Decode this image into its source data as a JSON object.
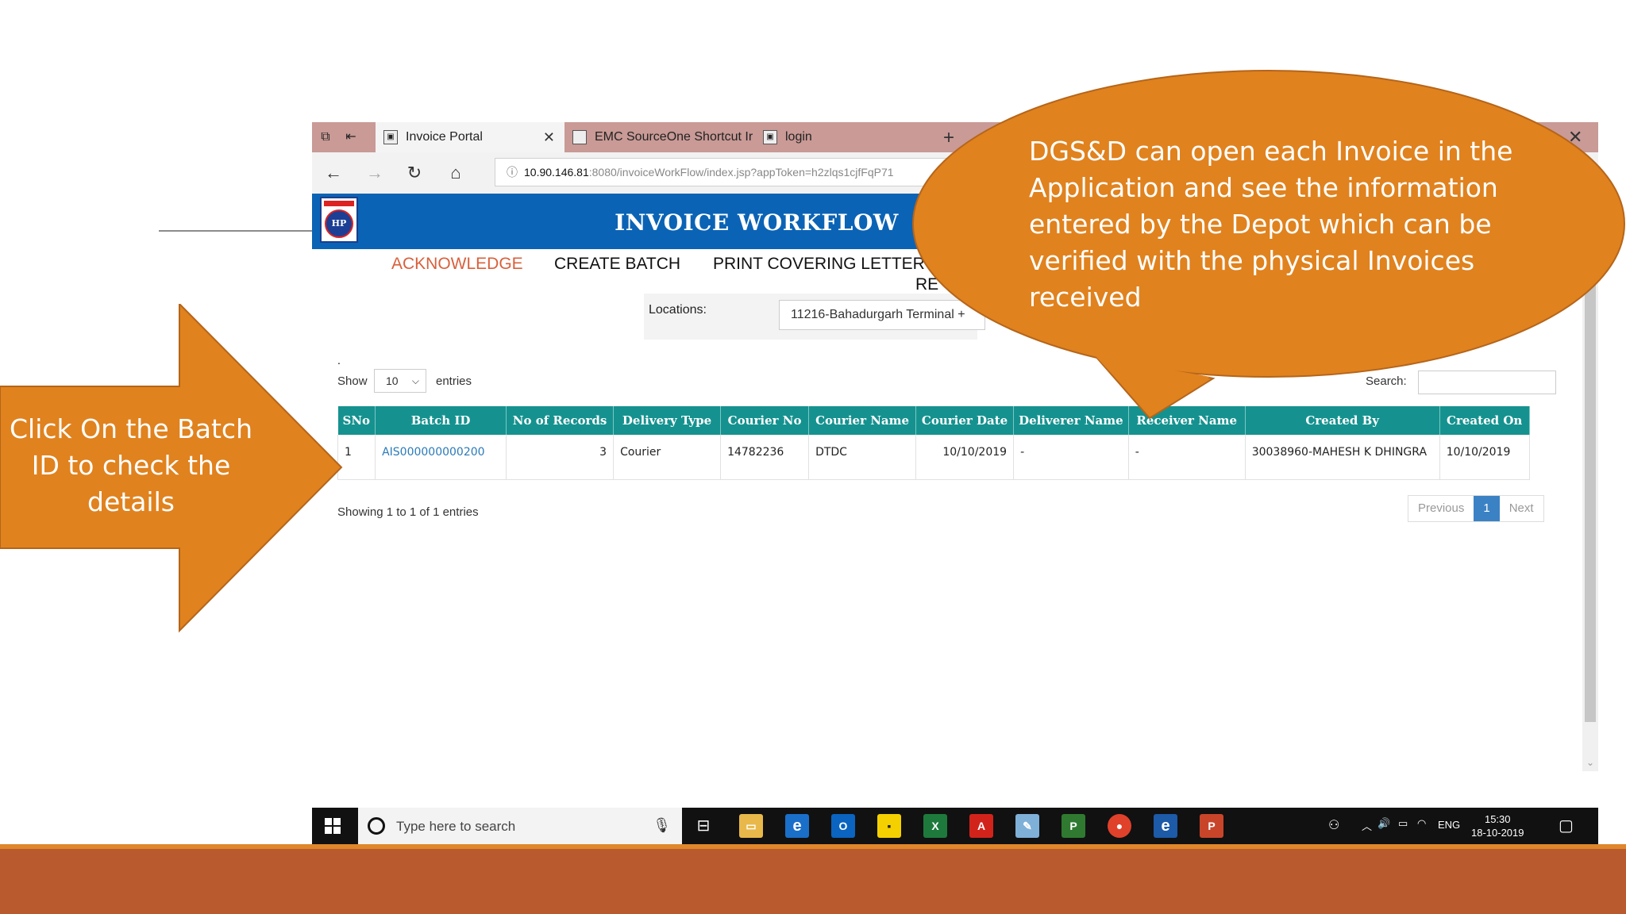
{
  "browser": {
    "tabs": [
      {
        "label": "Invoice Portal",
        "active": true
      },
      {
        "label": "EMC SourceOne Shortcut Ir",
        "active": false
      },
      {
        "label": "login",
        "active": false
      }
    ],
    "url_host": "10.90.146.81",
    "url_path": ":8080/invoiceWorkFlow/index.jsp?appToken=h2zlqs1cjfFqP71"
  },
  "app": {
    "title": "INVOICE WORKFLOW",
    "logo_text": "HP",
    "menu": {
      "acknowledge": "ACKNOWLEDGE",
      "create_batch": "CREATE BATCH",
      "print_covering_letter": "PRINT COVERING LETTER",
      "re": "RE"
    },
    "locations_label": "Locations:",
    "location_value": "11216-Bahadurgarh Terminal +"
  },
  "table_controls": {
    "dot": ".",
    "show_label": "Show",
    "page_size": "10",
    "entries_label": "entries",
    "search_label": "Search:"
  },
  "table": {
    "headers": [
      "SNo",
      "Batch ID",
      "No of Records",
      "Delivery Type",
      "Courier No",
      "Courier Name",
      "Courier Date",
      "Deliverer Name",
      "Receiver Name",
      "Created By",
      "Created On"
    ],
    "rows": [
      {
        "sno": "1",
        "batch_id": "AIS000000000200",
        "no_of_records": "3",
        "delivery_type": "Courier",
        "courier_no": "14782236",
        "courier_name": "DTDC",
        "courier_date": "10/10/2019",
        "deliverer_name": "-",
        "receiver_name": "-",
        "created_by": "30038960-MAHESH K DHINGRA",
        "created_on": "10/10/2019"
      }
    ]
  },
  "footer": {
    "showing": "Showing 1 to 1 of 1 entries",
    "previous": "Previous",
    "page": "1",
    "next": "Next"
  },
  "taskbar": {
    "search_placeholder": "Type here to search",
    "language": "ENG",
    "time": "15:30",
    "date": "18-10-2019"
  },
  "callouts": {
    "arrow_text": "Click On the Batch ID to check the details",
    "bubble_text": " DGS&D can open each Invoice in the Application and see the information entered by the Depot which can be verified with the physical Invoices received"
  },
  "colors": {
    "callout_orange": "#e0821e",
    "header_blue": "#0b63b5",
    "table_teal": "#15928f",
    "menu_active": "#d9603b",
    "bottom_strip": "#b85a2d"
  }
}
